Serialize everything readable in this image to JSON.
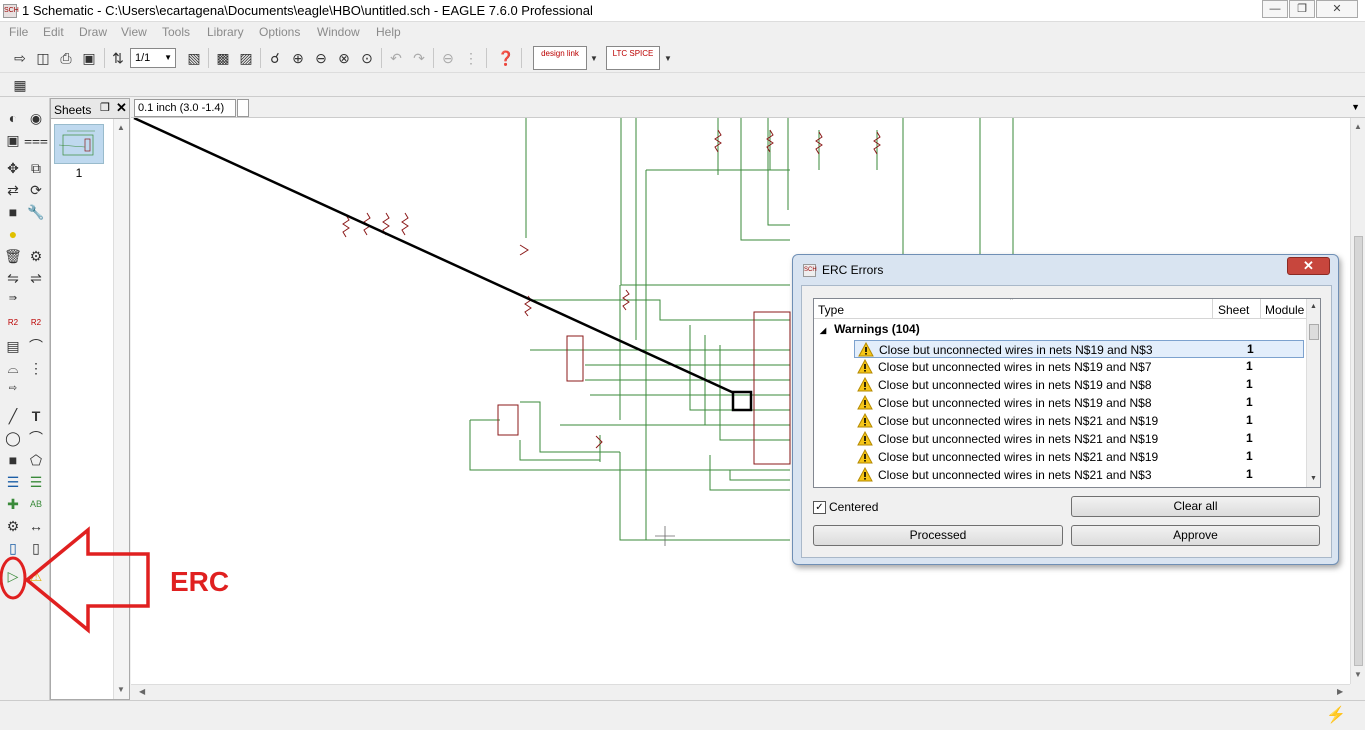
{
  "window": {
    "title": "1 Schematic - C:\\Users\\ecartagena\\Documents\\eagle\\HBO\\untitled.sch - EAGLE 7.6.0 Professional",
    "app_icon": "SCH"
  },
  "menu": [
    "File",
    "Edit",
    "Draw",
    "View",
    "Tools",
    "Library",
    "Options",
    "Window",
    "Help"
  ],
  "toolbar": {
    "zoom_select": "1/1",
    "designlink_label": "design link",
    "ltspice_label": "LTC SPICE"
  },
  "sheets": {
    "title": "Sheets",
    "close": "✕",
    "dock": "❐",
    "sheet_number": "1"
  },
  "coord": {
    "value": "0.1 inch (3.0 -1.4)"
  },
  "dialog": {
    "title": "ERC Errors",
    "close": "✕",
    "columns": [
      "Type",
      "Sheet",
      "Module"
    ],
    "group": "Warnings (104)",
    "rows": [
      {
        "text": "Close but unconnected wires in nets N$19 and N$3",
        "sheet": "1"
      },
      {
        "text": "Close but unconnected wires in nets N$19 and N$7",
        "sheet": "1"
      },
      {
        "text": "Close but unconnected wires in nets N$19 and N$8",
        "sheet": "1"
      },
      {
        "text": "Close but unconnected wires in nets N$19 and N$8",
        "sheet": "1"
      },
      {
        "text": "Close but unconnected wires in nets N$21 and N$19",
        "sheet": "1"
      },
      {
        "text": "Close but unconnected wires in nets N$21 and N$19",
        "sheet": "1"
      },
      {
        "text": "Close but unconnected wires in nets N$21 and N$19",
        "sheet": "1"
      },
      {
        "text": "Close but unconnected wires in nets N$21 and N$3",
        "sheet": "1"
      }
    ],
    "centered_label": "Centered",
    "centered_checked": true,
    "buttons": {
      "clear_all": "Clear all",
      "processed": "Processed",
      "approve": "Approve"
    }
  },
  "annotation": {
    "label": "ERC",
    "color": "#e02020"
  },
  "colors": {
    "net": "#3a8a3a",
    "part": "#8b1a1a",
    "selection": "#e3eefb"
  }
}
